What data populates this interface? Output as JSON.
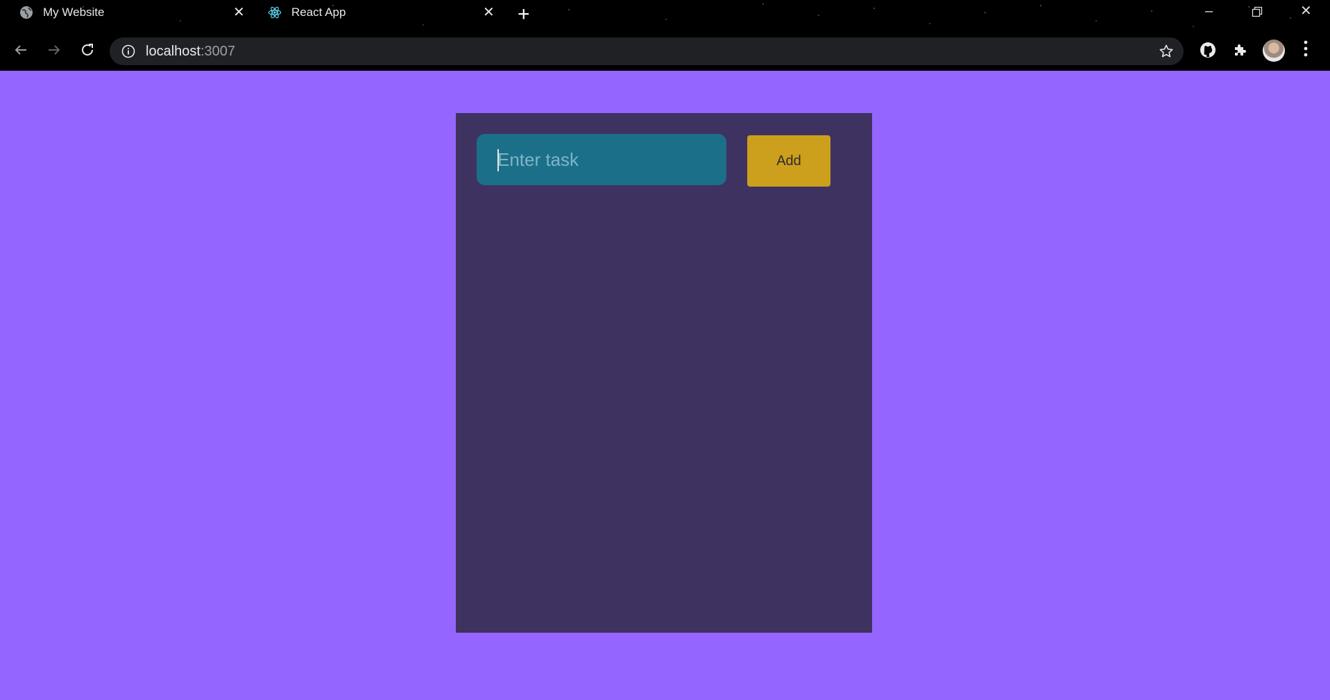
{
  "browser": {
    "tabs": [
      {
        "title": "My Website",
        "icon": "globe-icon"
      },
      {
        "title": "React App",
        "icon": "react-icon"
      }
    ],
    "address": {
      "host": "localhost",
      "port": ":3007"
    }
  },
  "app": {
    "task_input": {
      "placeholder": "Enter task",
      "value": ""
    },
    "add_label": "Add"
  },
  "colors": {
    "page_background": "#9466ff",
    "card_background": "#3e3261",
    "input_background": "#1b6f88",
    "button_background": "#cc9f1d"
  }
}
